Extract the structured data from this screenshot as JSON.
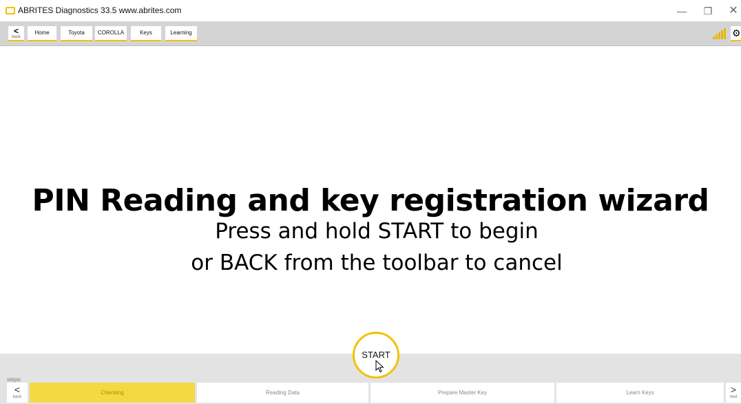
{
  "window": {
    "title": "ABRITES Diagnostics 33.5   www.abrites.com",
    "minimize": "—",
    "maximize": "❐",
    "close": "✕"
  },
  "toolbar": {
    "back_label": "back",
    "back_glyph": "<",
    "breadcrumbs": [
      "Home",
      "Toyota",
      "COROLLA",
      "Keys",
      "Learning"
    ],
    "icons": [
      "signal-icon",
      "gear-icon"
    ]
  },
  "main": {
    "headline": "PIN Reading and key registration wizard",
    "instruction_1": "Press and hold START to begin",
    "instruction_2": "or BACK from the toolbar to cancel",
    "start_label": "START"
  },
  "steps": {
    "label": "steps:",
    "back_label": "back",
    "back_glyph": "<",
    "next_label": "next",
    "next_glyph": ">",
    "items": [
      "Checking",
      "Reading Data",
      "Prepare Master Key",
      "Learn Keys"
    ],
    "active_index": 0
  },
  "colors": {
    "accent": "#f2c200",
    "toolbar_bg": "#d4d4d4",
    "steps_bg": "#e3e3e3",
    "active_step": "#f5d942"
  }
}
